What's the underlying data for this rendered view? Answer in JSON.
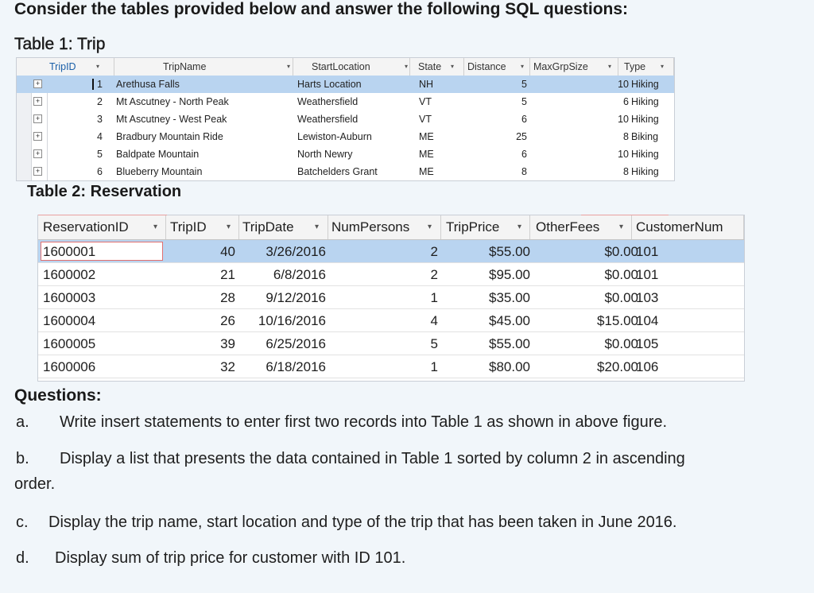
{
  "heading": "Consider the tables provided below and answer the following SQL questions:",
  "table1": {
    "caption": "Table 1: Trip",
    "columns": [
      "TripID",
      "TripName",
      "StartLocation",
      "State",
      "Distance",
      "MaxGrpSize",
      "Type"
    ],
    "rows": [
      [
        "1",
        "Arethusa Falls",
        "Harts Location",
        "NH",
        "5",
        "10",
        "Hiking"
      ],
      [
        "2",
        "Mt Ascutney - North Peak",
        "Weathersfield",
        "VT",
        "5",
        "6",
        "Hiking"
      ],
      [
        "3",
        "Mt Ascutney - West Peak",
        "Weathersfield",
        "VT",
        "6",
        "10",
        "Hiking"
      ],
      [
        "4",
        "Bradbury Mountain Ride",
        "Lewiston-Auburn",
        "ME",
        "25",
        "8",
        "Biking"
      ],
      [
        "5",
        "Baldpate Mountain",
        "North Newry",
        "ME",
        "6",
        "10",
        "Hiking"
      ],
      [
        "6",
        "Blueberry Mountain",
        "Batchelders Grant",
        "ME",
        "8",
        "8",
        "Hiking"
      ]
    ],
    "expander_glyph": "+",
    "dropdown_glyph": "▾"
  },
  "table2": {
    "caption": "Table 2: Reservation",
    "columns": [
      "ReservationID",
      "TripID",
      "TripDate",
      "NumPersons",
      "TripPrice",
      "OtherFees",
      "CustomerNum"
    ],
    "rows": [
      [
        "1600001",
        "40",
        "3/26/2016",
        "2",
        "$55.00",
        "$0.00",
        "101"
      ],
      [
        "1600002",
        "21",
        "6/8/2016",
        "2",
        "$95.00",
        "$0.00",
        "101"
      ],
      [
        "1600003",
        "28",
        "9/12/2016",
        "1",
        "$35.00",
        "$0.00",
        "103"
      ],
      [
        "1600004",
        "26",
        "10/16/2016",
        "4",
        "$45.00",
        "$15.00",
        "104"
      ],
      [
        "1600005",
        "39",
        "6/25/2016",
        "5",
        "$55.00",
        "$0.00",
        "105"
      ],
      [
        "1600006",
        "32",
        "6/18/2016",
        "1",
        "$80.00",
        "$20.00",
        "106"
      ]
    ]
  },
  "questions": {
    "title": "Questions:",
    "items": [
      {
        "letter": "a.",
        "text": "Write insert statements to enter first two records into Table 1 as shown in above figure."
      },
      {
        "letter": "b.",
        "text": "Display a list that presents the data contained in Table 1 sorted by column 2 in ascending",
        "text2": "order."
      },
      {
        "letter": "c.",
        "text": "Display the trip name, start location and type of the trip  that has been taken in June 2016."
      },
      {
        "letter": "d.",
        "text": "Display sum of trip price for customer with ID 101."
      }
    ]
  },
  "colors": {
    "selected_row": "#b9d4f0",
    "background": "#f1f6fa"
  }
}
